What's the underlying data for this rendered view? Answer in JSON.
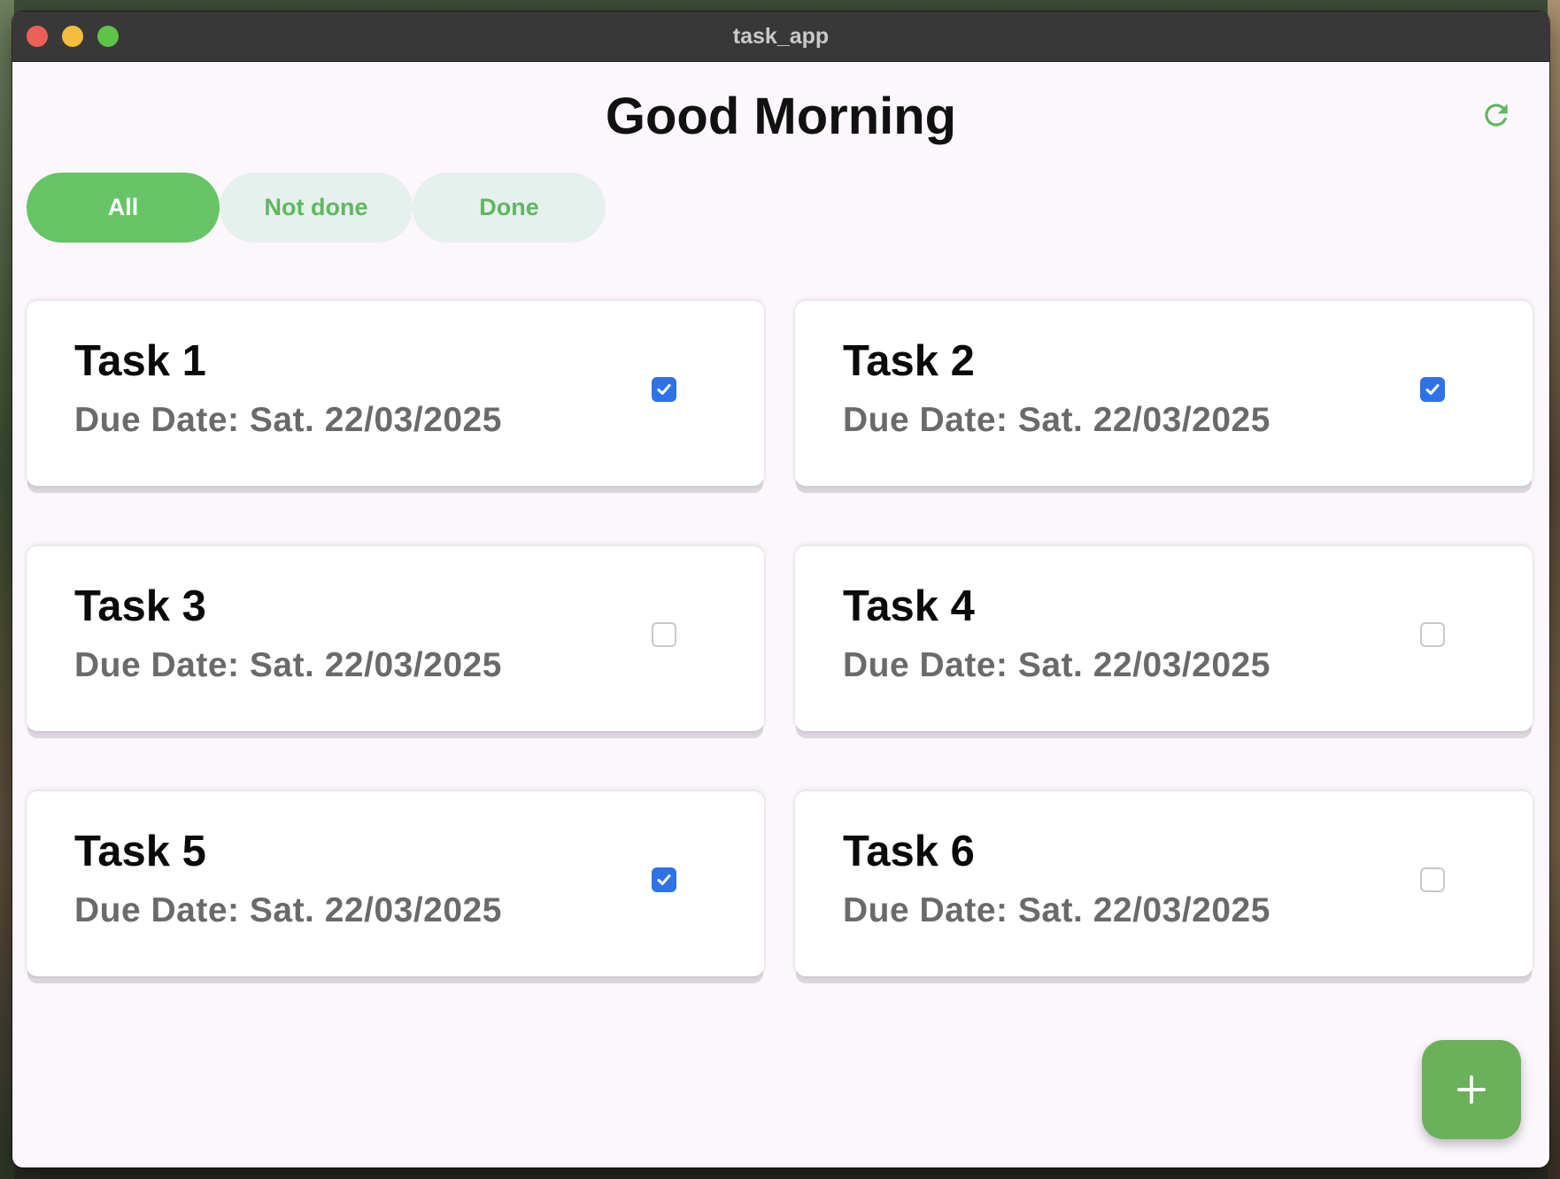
{
  "window": {
    "title": "task_app"
  },
  "header": {
    "greeting": "Good Morning",
    "refresh_icon": "refresh-icon"
  },
  "filters": [
    {
      "label": "All",
      "active": true
    },
    {
      "label": "Not done",
      "active": false
    },
    {
      "label": "Done",
      "active": false
    }
  ],
  "tasks": [
    {
      "title": "Task 1",
      "due": "Due Date: Sat. 22/03/2025",
      "done": true
    },
    {
      "title": "Task 2",
      "due": "Due Date: Sat. 22/03/2025",
      "done": true
    },
    {
      "title": "Task 3",
      "due": "Due Date: Sat. 22/03/2025",
      "done": false
    },
    {
      "title": "Task 4",
      "due": "Due Date: Sat. 22/03/2025",
      "done": false
    },
    {
      "title": "Task 5",
      "due": "Due Date: Sat. 22/03/2025",
      "done": true
    },
    {
      "title": "Task 6",
      "due": "Due Date: Sat. 22/03/2025",
      "done": false
    }
  ],
  "fab": {
    "icon": "plus-icon"
  },
  "colors": {
    "accent": "#65c566",
    "chip_inactive_bg": "#e6f0ec",
    "checkbox_checked": "#2f72e8",
    "fab": "#6ab15a",
    "background": "#fcf7fc"
  }
}
